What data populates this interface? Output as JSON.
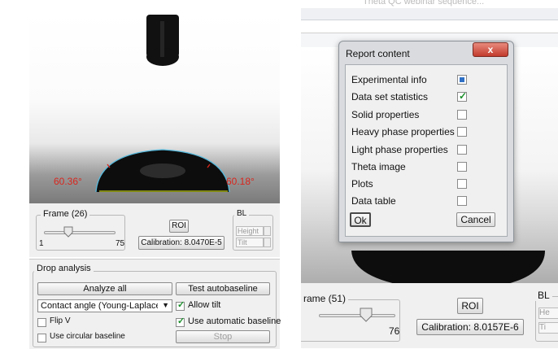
{
  "left_panel": {
    "frame": {
      "label": "Frame (26)",
      "min": "1",
      "max": "75",
      "value": 26
    },
    "roi_label": "ROI",
    "calibration_label": "Calibration: 8.0470E-5",
    "bl": {
      "label": "BL",
      "height_label": "Height",
      "tilt_label": "Tilt"
    },
    "angle_left": "60.36°",
    "angle_right": "60.18°",
    "drop_analysis": {
      "label": "Drop analysis",
      "analyze_all_label": "Analyze all",
      "test_autobaseline_label": "Test autobaseline",
      "method_value": "Contact angle (Young-Laplace)",
      "allow_tilt_label": "Allow tilt",
      "allow_tilt_checked": true,
      "flip_v_label": "Flip V",
      "flip_v_checked": false,
      "use_automatic_baseline_label": "Use automatic baseline",
      "use_automatic_baseline_checked": true,
      "use_circular_baseline_label": "Use circular baseline",
      "use_circular_baseline_checked": false,
      "stop_label": "Stop"
    }
  },
  "right_panel": {
    "top_text": "Theta QC webinar sequence...",
    "frame": {
      "label": "rame (51)",
      "max": "76",
      "value": 51
    },
    "roi_label": "ROI",
    "calibration_label": "Calibration: 8.0157E-6",
    "bl_label": "BL",
    "bl_height_label": "He",
    "bl_tilt_label": "Ti"
  },
  "dialog": {
    "title": "Report content",
    "close_label": "x",
    "items": [
      {
        "label": "Experimental info",
        "checked": true,
        "style": "box"
      },
      {
        "label": "Data set statistics",
        "checked": true,
        "style": "check"
      },
      {
        "label": "Solid properties",
        "checked": false
      },
      {
        "label": "Heavy phase properties",
        "checked": false
      },
      {
        "label": "Light phase properties",
        "checked": false
      },
      {
        "label": "Theta image",
        "checked": false
      },
      {
        "label": "Plots",
        "checked": false
      },
      {
        "label": "Data table",
        "checked": false
      }
    ],
    "ok_label": "Ok",
    "cancel_label": "Cancel"
  },
  "colors": {
    "angle_text": "#d8261e",
    "baseline": "#c6d21a",
    "drop_edge": "#56b9dc",
    "dialog_title_bar": "#d7d9dc",
    "close_button": "#c9392b"
  }
}
